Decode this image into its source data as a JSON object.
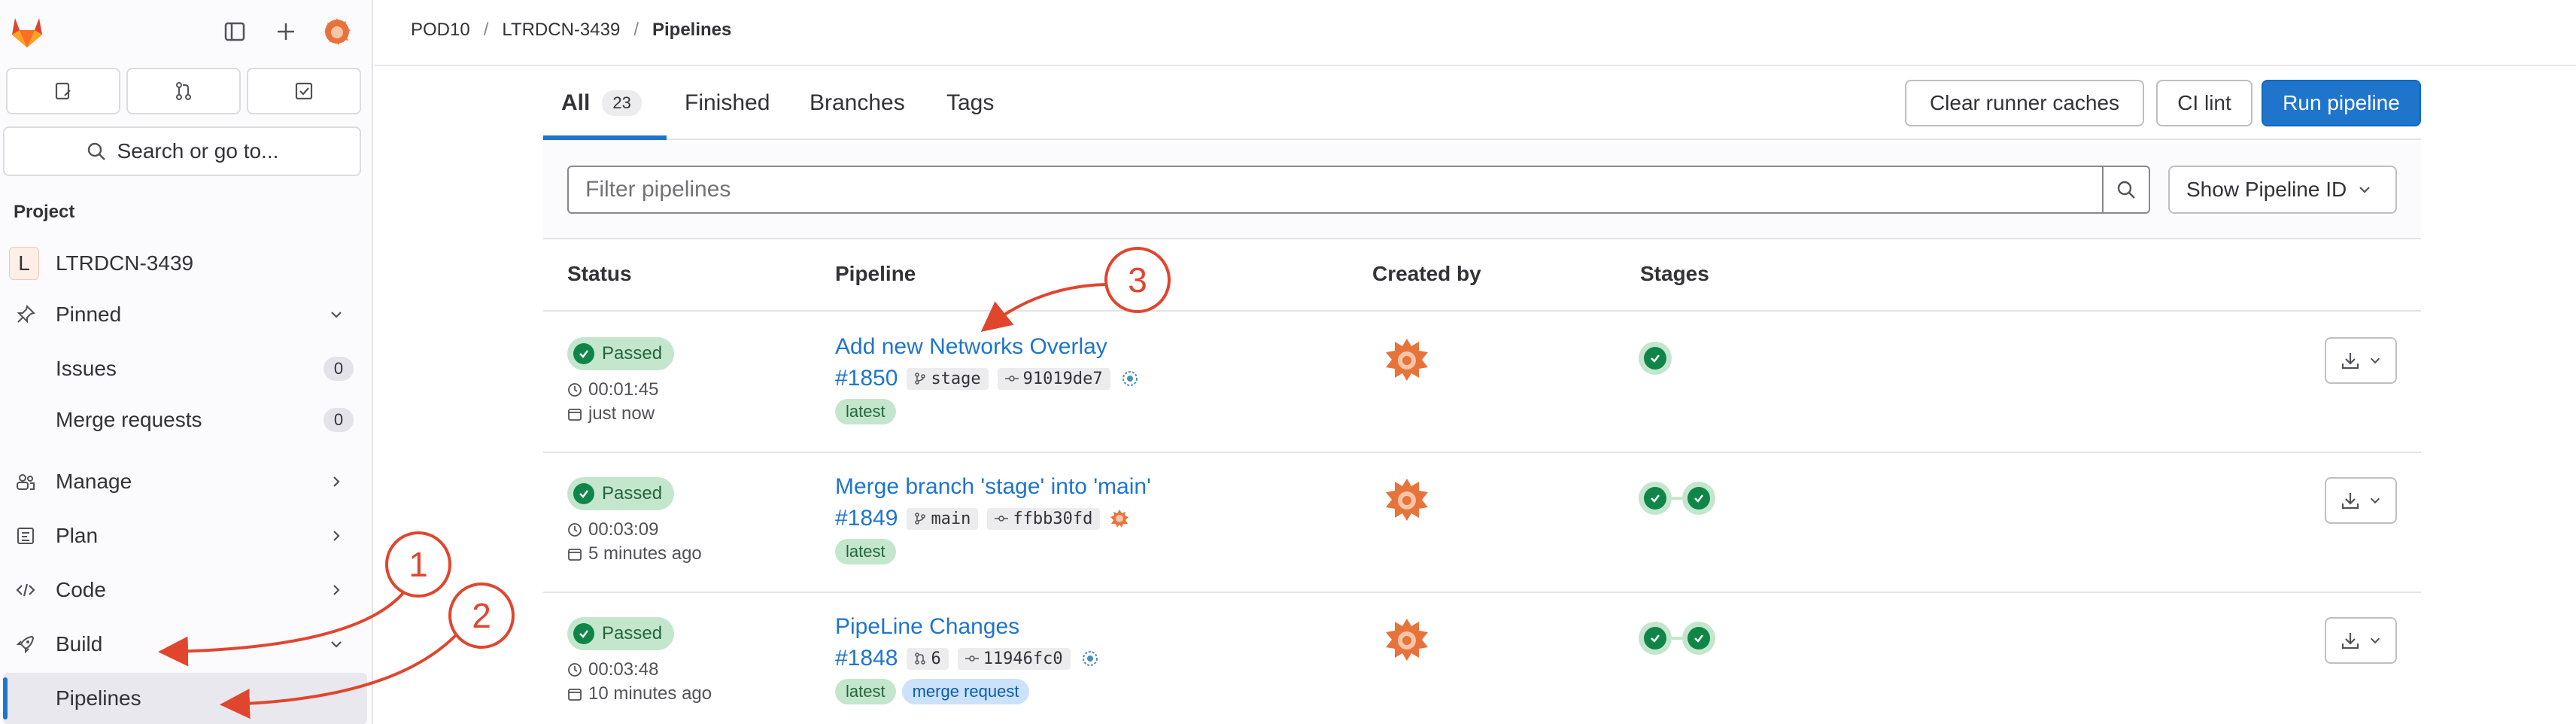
{
  "sidebar": {
    "search_label": "Search or go to...",
    "section_label": "Project",
    "project": {
      "initial": "L",
      "name": "LTRDCN-3439"
    },
    "items": [
      {
        "label": "Pinned",
        "icon": "pin-icon"
      },
      {
        "label": "Issues",
        "count": "0"
      },
      {
        "label": "Merge requests",
        "count": "0"
      },
      {
        "label": "Manage",
        "icon": "users-icon"
      },
      {
        "label": "Plan",
        "icon": "planning-icon"
      },
      {
        "label": "Code",
        "icon": "code-icon"
      },
      {
        "label": "Build",
        "icon": "rocket-icon"
      },
      {
        "label": "Pipelines"
      }
    ]
  },
  "breadcrumb": [
    "POD10",
    "LTRDCN-3439",
    "Pipelines"
  ],
  "tabs": [
    {
      "label": "All",
      "count": "23"
    },
    {
      "label": "Finished"
    },
    {
      "label": "Branches"
    },
    {
      "label": "Tags"
    }
  ],
  "actions": {
    "clear_caches": "Clear runner caches",
    "ci_lint": "CI lint",
    "run_pipeline": "Run pipeline"
  },
  "filter": {
    "placeholder": "Filter pipelines",
    "show_id": "Show Pipeline ID"
  },
  "table": {
    "headers": [
      "Status",
      "Pipeline",
      "Created by",
      "Stages"
    ],
    "rows": [
      {
        "status": "Passed",
        "duration": "00:01:45",
        "finished": "just now",
        "title": "Add new Networks Overlay",
        "id": "#1850",
        "ref": "stage",
        "sha": "91019de7",
        "tags": [
          "latest"
        ],
        "stages": 1
      },
      {
        "status": "Passed",
        "duration": "00:03:09",
        "finished": "5 minutes ago",
        "title": "Merge branch 'stage' into 'main'",
        "id": "#1849",
        "ref": "main",
        "sha": "ffbb30fd",
        "tags": [
          "latest"
        ],
        "stages": 2
      },
      {
        "status": "Passed",
        "duration": "00:03:48",
        "finished": "10 minutes ago",
        "title": "PipeLine Changes",
        "id": "#1848",
        "ref": "6",
        "sha": "11946fc0",
        "tags": [
          "latest",
          "merge request"
        ],
        "stages": 2
      }
    ]
  },
  "annotations": [
    "1",
    "2",
    "3"
  ],
  "colors": {
    "accent": "#1f75cb",
    "annotation_red": "#e0462e",
    "passed_bg": "#c3e6cd",
    "passed_fg": "#108548"
  }
}
